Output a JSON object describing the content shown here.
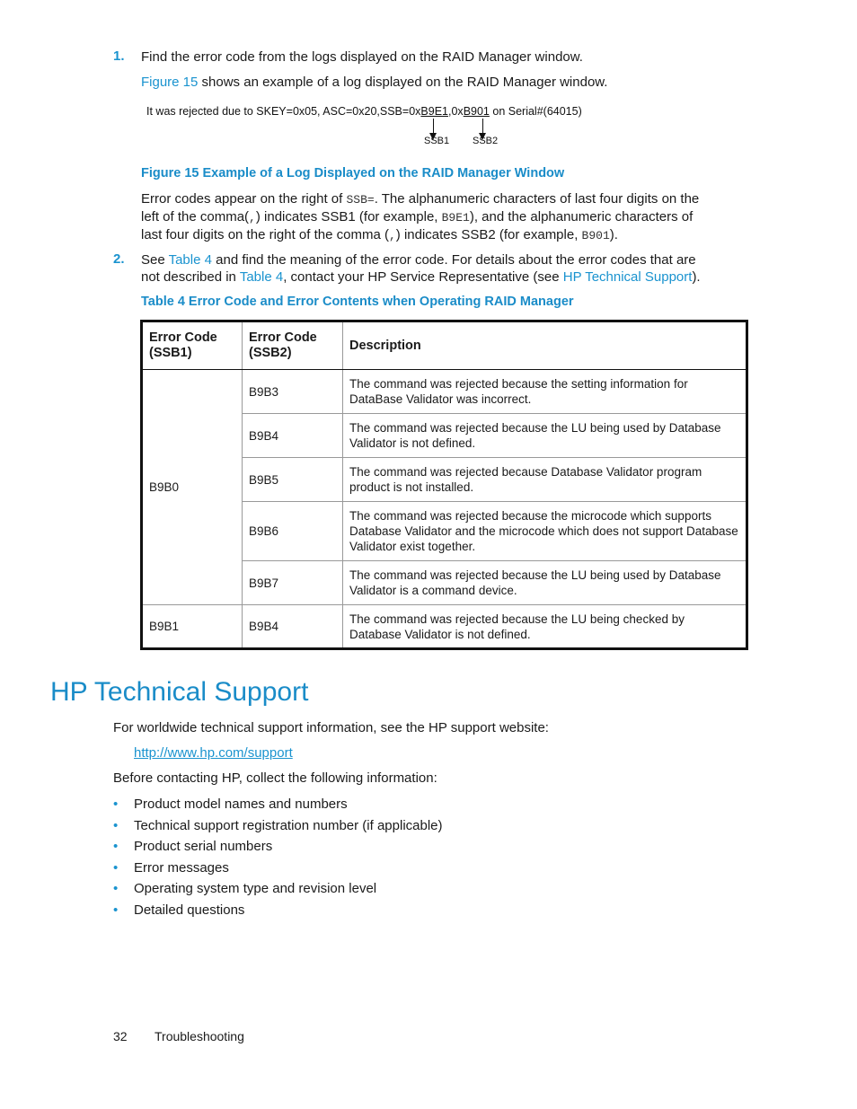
{
  "steps": [
    {
      "number": "1.",
      "text": "Find the error code from the logs displayed on the RAID Manager window.",
      "figure_ref": {
        "link": "Figure 15",
        "text": " shows an example of a log displayed on the RAID Manager window."
      }
    },
    {
      "number": "2.",
      "parts": {
        "p1": "See ",
        "link1": "Table 4",
        "p2": " and find the meaning of the error code. For details about the error codes that are",
        "p3": "not described in ",
        "link2": "Table 4",
        "p4": ", contact your HP Service Representative (see ",
        "link3": "HP Technical Support",
        "p5": ")."
      }
    }
  ],
  "figure": {
    "log_prefix": "It was rejected due to SKEY=0x05, ASC=0x20,SSB=0x",
    "ssb1_value": "B9E1",
    "sep": ",0x",
    "ssb2_value": "B901",
    "log_suffix": " on Serial#(64015)",
    "label1": "SSB1",
    "label2": "SSB2",
    "caption": "Figure 15 Example of a Log Displayed on the RAID Manager Window"
  },
  "explanation": {
    "l1a": "Error codes appear on the right of ",
    "l1code": "SSB=",
    "l1b": ". The alphanumeric characters of last four digits on the",
    "l2a": "left of the comma(",
    "l2code": ",",
    "l2b": ") indicates SSB1 (for example, ",
    "l2code2": "B9E1",
    "l2c": "), and the alphanumeric characters of",
    "l3a": "last four digits on the right of the comma (",
    "l3code": ",",
    "l3b": ") indicates SSB2 (for example, ",
    "l3code2": "B901",
    "l3c": ")."
  },
  "table": {
    "caption": "Table 4 Error Code and Error Contents when Operating RAID Manager",
    "headers": {
      "ssb1_l1": "Error Code",
      "ssb1_l2": "(SSB1)",
      "ssb2_l1": "Error Code",
      "ssb2_l2": "(SSB2)",
      "description": "Description"
    },
    "groups": [
      {
        "ssb1": "B9B0",
        "rows": [
          {
            "ssb2": "B9B3",
            "description": "The command was rejected because the setting information for DataBase Validator was incorrect."
          },
          {
            "ssb2": "B9B4",
            "description": "The command was rejected because the LU being used by Database Validator is not defined."
          },
          {
            "ssb2": "B9B5",
            "description": "The command was rejected because Database Validator program product is not installed."
          },
          {
            "ssb2": "B9B6",
            "description": "The command was rejected because the microcode which supports Database Validator and the microcode which does not support Database Validator exist together."
          },
          {
            "ssb2": "B9B7",
            "description": "The command was rejected because the LU being used by Database Validator is a command device."
          }
        ]
      },
      {
        "ssb1": "B9B1",
        "rows": [
          {
            "ssb2": "B9B4",
            "description": "The command was rejected because the LU being checked by Database Validator is not defined."
          }
        ]
      }
    ]
  },
  "support": {
    "title": "HP Technical Support",
    "intro": "For worldwide technical support information, see the HP support website:",
    "url": "http://www.hp.com/support",
    "before": "Before contacting HP, collect the following information:",
    "bullet_glyph": "•",
    "items": [
      "Product model names and numbers",
      "Technical support registration number (if applicable)",
      "Product serial numbers",
      "Error messages",
      "Operating system type and revision level",
      "Detailed questions"
    ]
  },
  "footer": {
    "page_number": "32",
    "section": "Troubleshooting"
  },
  "colors": {
    "accent": "#1a93cf",
    "text": "#1a1a1a"
  }
}
